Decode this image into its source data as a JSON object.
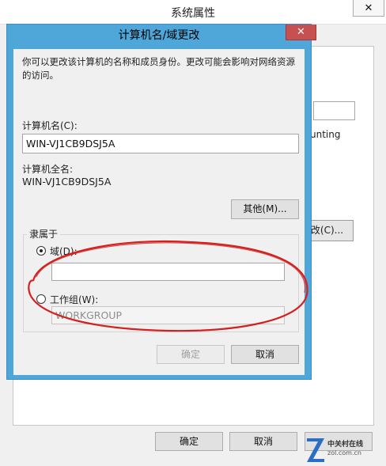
{
  "background_window": {
    "title": "系统属性",
    "close_symbol": "✕",
    "partial_text": "unting",
    "change_button_partial": "改(C)...",
    "buttons": {
      "ok": "确定",
      "cancel": "取消"
    }
  },
  "dialog": {
    "title": "计算机名/域更改",
    "close_symbol": "✕",
    "description": "你可以更改该计算机的名称和成员身份。更改可能会影响对网络资源的访问。",
    "computer_name_label": "计算机名(C):",
    "computer_name_value": "WIN-VJ1CB9DSJ5A",
    "full_name_label": "计算机全名:",
    "full_name_value": "WIN-VJ1CB9DSJ5A",
    "more_button": "其他(M)...",
    "member_of_legend": "隶属于",
    "domain_label": "域(D):",
    "domain_value": "",
    "workgroup_label": "工作组(W):",
    "workgroup_value": "WORKGROUP",
    "buttons": {
      "ok": "确定",
      "cancel": "取消"
    }
  },
  "annotation": {
    "color": "#d42020"
  },
  "watermark": {
    "line1": "中关村在线",
    "line2": "zol.com.cn",
    "color": "#2a6fc4"
  },
  "colors": {
    "dialog_frame": "#4fa6d9",
    "close_button": "#c75050"
  }
}
